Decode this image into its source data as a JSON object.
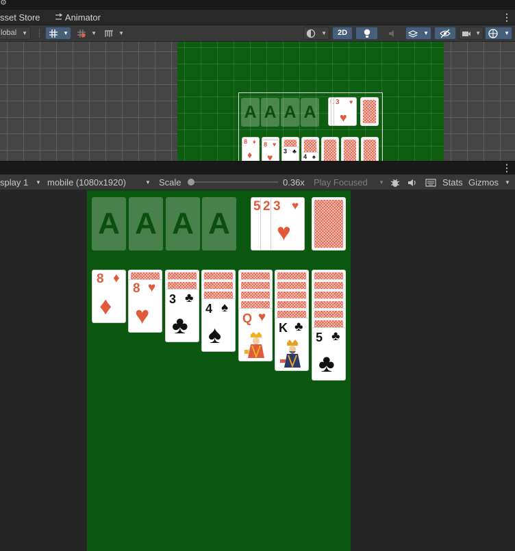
{
  "tabs": {
    "asset_store": "sset Store",
    "animator": "Animator",
    "animator_icon": "animator-icon"
  },
  "scene_toolbar": {
    "global_label": "lobal",
    "mode_2d": "2D",
    "icons": [
      "move-tool-icon",
      "grid-snap-icon",
      "increment-snap-icon",
      "render-mode-icon",
      "lighting-icon",
      "audio-mute-icon",
      "effects-icon",
      "visibility-icon",
      "camera-icon",
      "gizmo-icon"
    ]
  },
  "game_toolbar": {
    "display": "splay 1",
    "resolution": "mobile (1080x1920)",
    "scale_label": "Scale",
    "scale_value": "0.36x",
    "scale_fraction": 0.0,
    "play_mode": "Play Focused",
    "stats": "Stats",
    "gizmos": "Gizmos",
    "icons": [
      "bug-icon",
      "audio-icon",
      "keyboard-icon"
    ]
  },
  "colors": {
    "felt": "#0c5710",
    "red_suit": "#e05a3c",
    "card_back": "#e25d45",
    "active_button": "#46607c"
  },
  "game": {
    "foundations": [
      "A",
      "A",
      "A",
      "A"
    ],
    "waste_ranks": [
      "5",
      "2",
      "3"
    ],
    "waste_top_suit": "♥",
    "tableau": [
      {
        "rank": "8",
        "suit": "♦"
      },
      {
        "rank": "8",
        "suit": "♥"
      },
      {
        "rank": "3",
        "suit": "♣"
      },
      {
        "rank": "4",
        "suit": "♠"
      },
      {
        "rank": "Q",
        "suit": "♥"
      },
      {
        "rank": "K",
        "suit": "♣"
      },
      {
        "rank": "5",
        "suit": "♣"
      }
    ]
  }
}
